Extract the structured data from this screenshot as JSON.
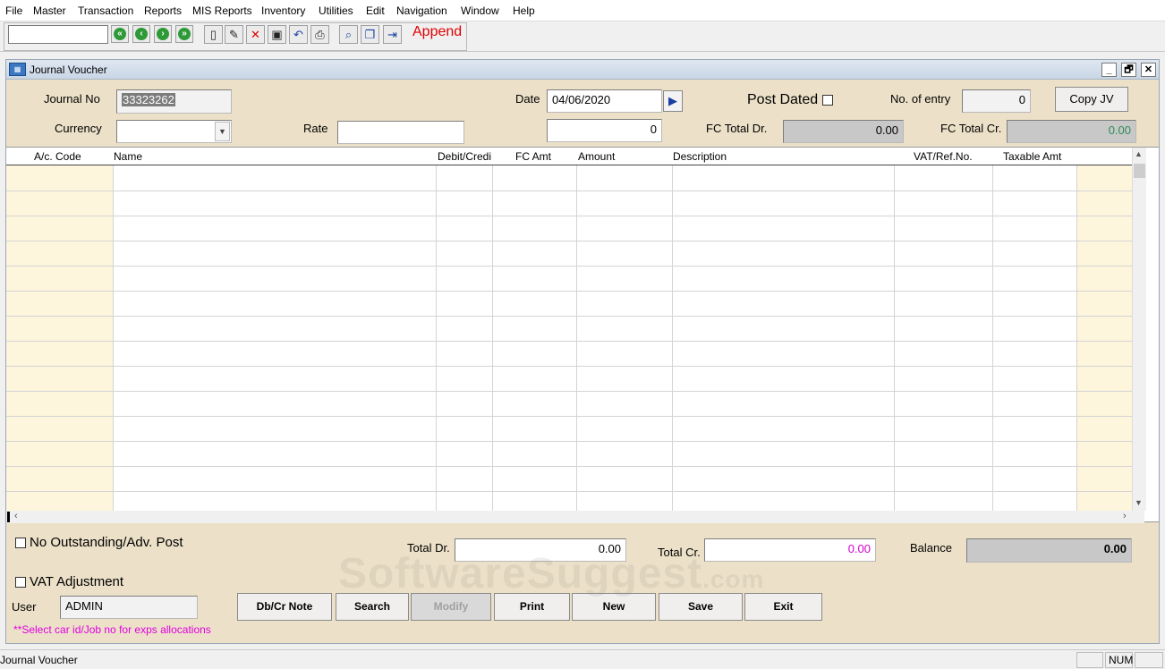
{
  "menu": [
    "File",
    "Master",
    "Transaction",
    "Reports",
    "MIS Reports",
    "Inventory",
    "Utilities",
    "Edit",
    "Navigation",
    "Window",
    "Help"
  ],
  "toolbar": {
    "mode_label": "Append",
    "nav_icons": [
      "first-record-icon",
      "previous-record-icon",
      "next-record-icon",
      "last-record-icon"
    ],
    "tool_icons": [
      "new-document-icon",
      "edit-icon",
      "delete-icon",
      "save-icon",
      "undo-icon",
      "print-icon",
      "find-icon",
      "windows-icon",
      "exit-icon"
    ]
  },
  "window": {
    "title": "Journal Voucher",
    "controls": {
      "minimize": "_",
      "restore": "🗗",
      "close": "✕"
    }
  },
  "form": {
    "journal_no_label": "Journal  No",
    "journal_no": "33323262",
    "currency_label": "Currency",
    "currency": "",
    "rate_label": "Rate",
    "rate": "",
    "date_label": "Date",
    "date": "04/06/2020",
    "fc_amount": "0",
    "post_dated_label": "Post Dated",
    "post_dated": false,
    "no_entry_label": "No.  of  entry",
    "no_entry": "0",
    "copy_jv_label": "Copy JV",
    "fc_total_dr_label": "FC Total  Dr.",
    "fc_total_dr": "0.00",
    "fc_total_cr_label": "FC Total Cr.",
    "fc_total_cr": "0.00",
    "fc_total_cr_color": "#2e8b57"
  },
  "grid": {
    "columns": [
      "A/c. Code",
      "Name",
      "Debit/Credi",
      "FC Amt",
      "Amount",
      "Description",
      "VAT/Ref.No.",
      "Taxable Amt"
    ],
    "rows": []
  },
  "footer": {
    "no_outstanding_label": "No Outstanding/Adv. Post",
    "no_outstanding": false,
    "vat_adjustment_label": "VAT Adjustment",
    "vat_adjustment": false,
    "total_dr_label": "Total Dr.",
    "total_dr": "0.00",
    "total_cr_label": "Total Cr.",
    "total_cr": "0.00",
    "total_cr_color": "#d100d1",
    "balance_label": "Balance",
    "balance": "0.00",
    "user_label": "User",
    "user": "ADMIN",
    "note": "**Select car id/Job no  for  exps allocations",
    "note_color": "#e000e0"
  },
  "buttons": {
    "dbcr_note": "Db/Cr Note",
    "search": "Search",
    "modify": "Modify",
    "print": "Print",
    "new": "New",
    "save": "Save",
    "exit": "Exit"
  },
  "statusbar": {
    "text": "Journal Voucher",
    "num": "NUM"
  },
  "watermark": {
    "main": "SoftwareSuggest",
    "suffix": ".com"
  }
}
